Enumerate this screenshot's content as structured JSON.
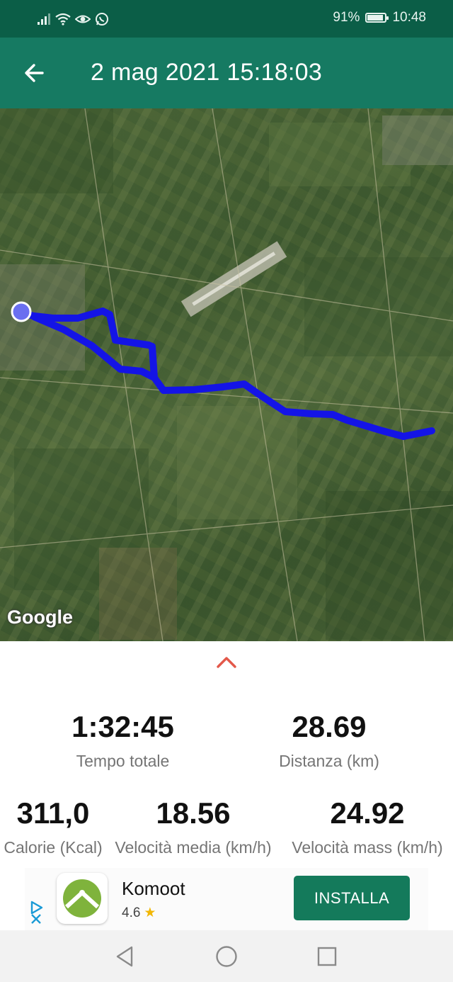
{
  "status_bar": {
    "battery": "91%",
    "battery_level": 0.91,
    "time": "10:48"
  },
  "app_bar": {
    "title": "2 mag 2021 15:18:03"
  },
  "map": {
    "attribution": "Google",
    "route_color": "#1414e6"
  },
  "stats": {
    "total_time": {
      "value": "1:32:45",
      "label": "Tempo totale"
    },
    "distance": {
      "value": "28.69",
      "label": "Distanza (km)"
    },
    "calories": {
      "value": "311,0",
      "label": "Calorie (Kcal)"
    },
    "avg_speed": {
      "value": "18.56",
      "label": "Velocità media (km/h)"
    },
    "max_speed": {
      "value": "24.92",
      "label": "Velocità mass (km/h)"
    }
  },
  "ad": {
    "app_name": "Komoot",
    "rating": "4.6",
    "install_label": "INSTALLA"
  },
  "colors": {
    "status_bar": "#0b5e47",
    "app_bar": "#167a62",
    "install": "#147a5b",
    "chevron": "#e3584a"
  }
}
